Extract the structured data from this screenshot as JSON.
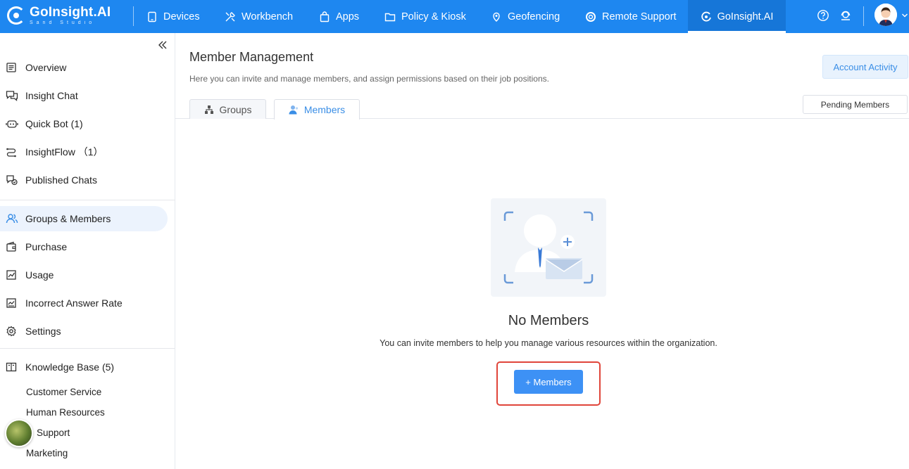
{
  "topbar": {
    "brand": "GoInsight.AI",
    "brand_sub": "Sand Studio",
    "nav": [
      {
        "label": "Devices",
        "icon": "tablet-icon"
      },
      {
        "label": "Workbench",
        "icon": "tools-icon"
      },
      {
        "label": "Apps",
        "icon": "bag-icon"
      },
      {
        "label": "Policy & Kiosk",
        "icon": "folder-icon"
      },
      {
        "label": "Geofencing",
        "icon": "location-icon"
      },
      {
        "label": "Remote Support",
        "icon": "lifebuoy-icon"
      },
      {
        "label": "GoInsight.AI",
        "icon": "goinsight-icon",
        "active": true
      }
    ]
  },
  "sidebar": {
    "items": [
      {
        "label": "Overview",
        "icon": "document-icon"
      },
      {
        "label": "Insight Chat",
        "icon": "chat-icon"
      },
      {
        "label": "Quick Bot (1)",
        "icon": "bot-icon"
      },
      {
        "label": "InsightFlow （1）",
        "icon": "flow-icon"
      },
      {
        "label": "Published Chats",
        "icon": "published-chat-icon"
      },
      {
        "label": "Groups & Members",
        "icon": "users-icon",
        "active": true
      },
      {
        "label": "Purchase",
        "icon": "wallet-icon"
      },
      {
        "label": "Usage",
        "icon": "chart-icon"
      },
      {
        "label": "Incorrect Answer Rate",
        "icon": "trend-icon"
      },
      {
        "label": "Settings",
        "icon": "gear-icon"
      },
      {
        "label": "Knowledge Base (5)",
        "icon": "book-icon"
      }
    ],
    "knowledge_base": [
      "Customer Service",
      "Human Resources",
      "Support",
      "Marketing"
    ]
  },
  "main": {
    "title": "Member Management",
    "subtitle": "Here you can invite and manage members, and assign permissions based on their job positions.",
    "account_activity": "Account Activity",
    "tabs": [
      {
        "label": "Groups",
        "icon": "org-icon"
      },
      {
        "label": "Members",
        "icon": "user-icon",
        "active": true
      }
    ],
    "pending_members": "Pending Members",
    "empty": {
      "title": "No Members",
      "description": "You can invite members to help you manage various resources within the organization.",
      "button": "+ Members"
    }
  },
  "colors": {
    "primary": "#1e87f0",
    "accent": "#3d91f5",
    "highlight": "#e0453a"
  }
}
